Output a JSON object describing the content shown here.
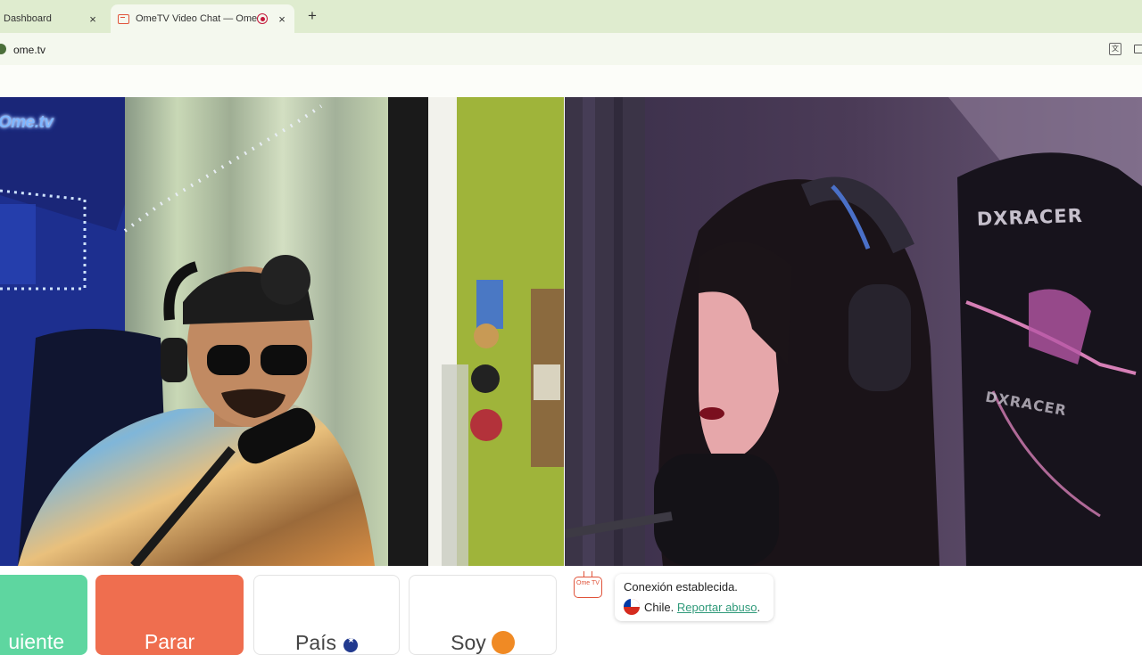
{
  "browser": {
    "tabs": [
      {
        "title": "Dashboard",
        "active": false,
        "icon": "close-icon"
      },
      {
        "title": "OmeTV Video Chat — Ome",
        "active": true,
        "recording": true
      }
    ],
    "new_tab_label": "+",
    "close_glyph": "×",
    "url": "ome.tv",
    "toolbar_icons": [
      "translate-icon",
      "cast-icon"
    ]
  },
  "video": {
    "local_watermark": "Ome.tv",
    "remote_chair_brand": "DXRACER"
  },
  "controls": {
    "next_label": "uiente",
    "stop_label": "Parar",
    "country_label": "País",
    "gender_label": "Soy"
  },
  "chat": {
    "logo_text": "Ome TV",
    "status": "Conexión establecida.",
    "country": "Chile.",
    "report_label": "Reportar abuso",
    "report_suffix": "."
  },
  "colors": {
    "tabstrip_bg": "#dfeccf",
    "next_button": "#5ed6a0",
    "stop_button": "#ef6e4f",
    "link": "#2f9a7a"
  }
}
